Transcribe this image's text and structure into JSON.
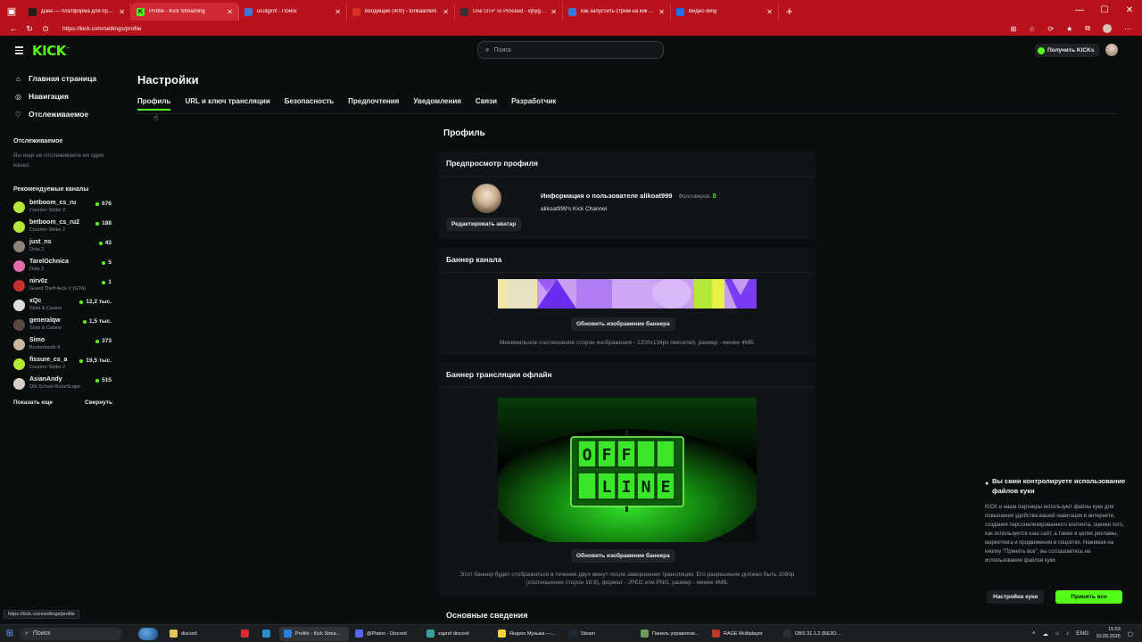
{
  "browser": {
    "tabs": [
      {
        "label": "Дзен — платформа для просмо",
        "fav_color": "#1f1f1f",
        "fav_text": ""
      },
      {
        "label": "Profile - Kick Streaming",
        "fav_color": "#53fc18",
        "fav_text": "K",
        "active": true
      },
      {
        "label": "ucutgxnf - Поиск",
        "fav_color": "#3b78e7",
        "fav_text": ""
      },
      {
        "label": "Входящие (400) - torikaardelli",
        "fav_color": "#d93025",
        "fav_text": ""
      },
      {
        "label": "Use OTP To Proceed - vjbygxd@",
        "fav_color": "#333",
        "fav_text": ""
      },
      {
        "label": "как запустить стрим на кик - П",
        "fav_color": "#3b78e7",
        "fav_text": ""
      },
      {
        "label": "Видео Bing",
        "fav_color": "#1a73e8",
        "fav_text": ""
      }
    ],
    "new_tab": "+",
    "url": "https://kick.com/settings/profile"
  },
  "topnav": {
    "logo": "KICK",
    "logo_mark": "™",
    "search_placeholder": "Поиск",
    "get_kicks": "Получить KICKs"
  },
  "sidebar": {
    "nav": [
      {
        "label": "Главная страница",
        "icon": "home-icon",
        "glyph": "⌂"
      },
      {
        "label": "Навигация",
        "icon": "compass-icon",
        "glyph": "◎"
      },
      {
        "label": "Отслеживаемое",
        "icon": "heart-icon",
        "glyph": "♡"
      }
    ],
    "following_title": "Отслеживаемое",
    "following_empty": "Вы еще не отслеживаете ни один канал.",
    "recommended_title": "Рекомендуемые каналы",
    "channels": [
      {
        "name": "betboom_cs_ru",
        "game": "Counter-Strike 2",
        "viewers": "676",
        "color": "#b6e83a"
      },
      {
        "name": "betboom_cs_ru2",
        "game": "Counter-Strike 2",
        "viewers": "188",
        "color": "#b6e83a"
      },
      {
        "name": "just_ns",
        "game": "Dota 2",
        "viewers": "43",
        "color": "#8d8377"
      },
      {
        "name": "TarelOchnica",
        "game": "Dota 2",
        "viewers": "5",
        "color": "#e06ea8"
      },
      {
        "name": "nirv0z",
        "game": "Grand Theft Auto V (GTA)",
        "viewers": "1",
        "color": "#c93030"
      },
      {
        "name": "xQc",
        "game": "Slots & Casino",
        "viewers": "12,2 тыс.",
        "color": "#dddddd"
      },
      {
        "name": "generalqw",
        "game": "Slots & Casino",
        "viewers": "1,5 тыс.",
        "color": "#5a4a40"
      },
      {
        "name": "Simo",
        "game": "Borderlands 4",
        "viewers": "373",
        "color": "#c9b9a0"
      },
      {
        "name": "fissure_cs_a",
        "game": "Counter-Strike 2",
        "viewers": "19,5 тыс.",
        "color": "#b6e83a"
      },
      {
        "name": "AsianAndy",
        "game": "Old School RuneScape",
        "viewers": "515",
        "color": "#d8d0c8"
      }
    ],
    "show_more": "Показать еще",
    "collapse": "Свернуть"
  },
  "settings": {
    "title": "Настройки",
    "tabs": [
      "Профиль",
      "URL и ключ трансляции",
      "Безопасность",
      "Предпочтения",
      "Уведомления",
      "Связи",
      "Разработчик"
    ],
    "active_tab": 0
  },
  "profile": {
    "section_title": "Профиль",
    "preview": {
      "heading": "Предпросмотр профиля",
      "user_info": "Информация о пользователе alikoat999",
      "followers_label": "Фолловеров:",
      "followers_value": "0",
      "channel_desc": "alikoat999's Kick Channel",
      "edit_avatar": "Редактировать аватар"
    },
    "banner": {
      "heading": "Баннер канала",
      "update_button": "Обновить изображение баннера",
      "hint": "Минимальное соотношение сторон изображения - 1200х134px пикселей, размер - менее 4MB."
    },
    "offline_banner": {
      "heading": "Баннер трансляции офлайн",
      "sign_top": [
        "O",
        "F",
        "F",
        "",
        ""
      ],
      "sign_bottom": [
        "",
        "L",
        "I",
        "N",
        "E"
      ],
      "update_button": "Обновить изображение баннера",
      "hint": "Этот баннер будет отображаться в течение двух минут после завершения трансляции. Его разрешение должно быть 1080p (соотношение сторон 16:9), формат - JPEG или PNG, размер - менее 4MB."
    },
    "basic_info_heading": "Основные сведения"
  },
  "cookie": {
    "title": "Вы сами контролируете использование файлов куки",
    "body": "KICK и наши партнеры используют файлы куки для повышения удобства вашей навигации в интернете, создания персонализированного контента, оценки того, как используется наш сайт, а также в целях рекламы, маркетинга и продвижения в соцсетях. Нажимая на кнопку \"Принять все\", вы соглашаетесь на использование файлов куки.",
    "settings_button": "Настройки куки",
    "accept_button": "Принять все"
  },
  "status_url": "https://kick.com/settings/profile",
  "taskbar": {
    "search": "Поиск",
    "items": [
      {
        "label": "discord",
        "color": "#e8c35a"
      },
      {
        "label": "",
        "color": "#d62b2b"
      },
      {
        "label": "",
        "color": "#2a8ad1"
      },
      {
        "label": "Profile - Kick Strea...",
        "color": "#2f7de1",
        "active": true
      },
      {
        "label": "@Platon - Discord",
        "color": "#5865f2"
      },
      {
        "label": "zapret discord",
        "color": "#3aa0a0"
      },
      {
        "label": "Яндекс Музыка —...",
        "color": "#f7d23b"
      },
      {
        "label": "Steam",
        "color": "#1b2838"
      },
      {
        "label": "Панель управлени...",
        "color": "#6e9b5a"
      },
      {
        "label": "RAGE Multiplayer",
        "color": "#c0392b"
      },
      {
        "label": "OBS 31.1.2 (БЕЗОП...",
        "color": "#302e31"
      }
    ],
    "lang": "ENG",
    "time": "15:53",
    "date": "10.09.2025"
  },
  "colors": {
    "accent": "#53fc18",
    "chrome": "#b8121d",
    "background": "#0b0e0f",
    "card": "#111416"
  }
}
